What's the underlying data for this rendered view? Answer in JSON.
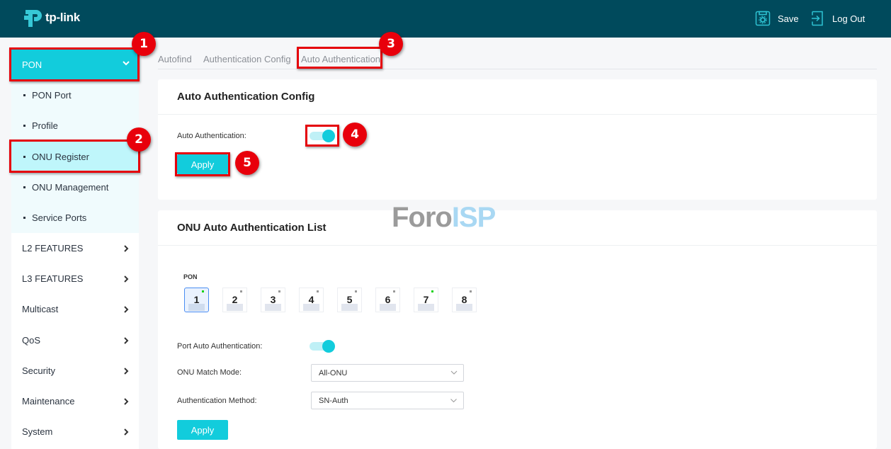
{
  "header": {
    "brand": "tp-link",
    "save_label": "Save",
    "logout_label": "Log Out"
  },
  "sidebar": {
    "pon": {
      "label": "PON",
      "expanded": true
    },
    "sub_items": [
      {
        "label": "PON Port"
      },
      {
        "label": "Profile"
      },
      {
        "label": "ONU Register",
        "active": true
      },
      {
        "label": "ONU Management"
      },
      {
        "label": "Service Ports"
      }
    ],
    "items": [
      {
        "label": "L2 FEATURES"
      },
      {
        "label": "L3 FEATURES"
      },
      {
        "label": "Multicast"
      },
      {
        "label": "QoS"
      },
      {
        "label": "Security"
      },
      {
        "label": "Maintenance"
      },
      {
        "label": "System"
      }
    ]
  },
  "tabs": [
    {
      "label": "Autofind"
    },
    {
      "label": "Authentication Config"
    },
    {
      "label": "Auto Authentication",
      "active": true
    }
  ],
  "config_card": {
    "title": "Auto Authentication Config",
    "auto_auth_label": "Auto Authentication:",
    "auto_auth_enabled": true,
    "apply_label": "Apply"
  },
  "list_card": {
    "title": "ONU Auto Authentication List",
    "pon_label": "PON",
    "ports": [
      {
        "num": "1",
        "link": "up",
        "selected": true
      },
      {
        "num": "2",
        "link": "down"
      },
      {
        "num": "3",
        "link": "down"
      },
      {
        "num": "4",
        "link": "down"
      },
      {
        "num": "5",
        "link": "down"
      },
      {
        "num": "6",
        "link": "down"
      },
      {
        "num": "7",
        "link": "up"
      },
      {
        "num": "8",
        "link": "down"
      }
    ],
    "port_auto_auth_label": "Port Auto Authentication:",
    "port_auto_auth_enabled": true,
    "match_mode_label": "ONU Match Mode:",
    "match_mode_value": "All-ONU",
    "auth_method_label": "Authentication Method:",
    "auth_method_value": "SN-Auth",
    "apply_label": "Apply"
  },
  "annotations": [
    "1",
    "2",
    "3",
    "4",
    "5"
  ],
  "watermark": {
    "part1": "Foro",
    "part2": "ISP"
  },
  "colors": {
    "header_bg": "#004a5c",
    "accent": "#12ccdc",
    "annotation_red": "#e5000a",
    "link_up": "#19d219"
  }
}
